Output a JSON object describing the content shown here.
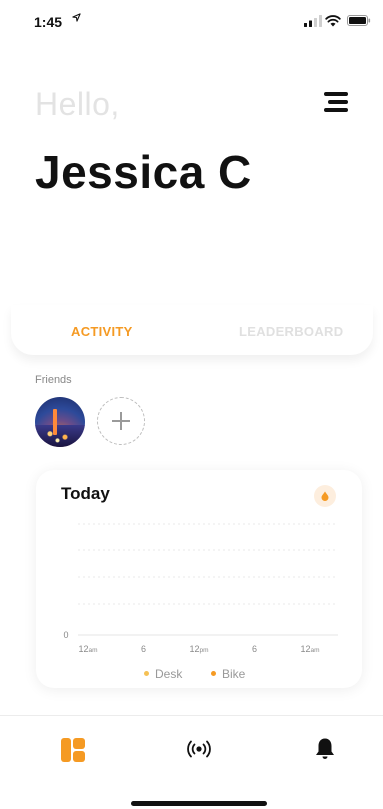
{
  "status_bar": {
    "time": "1:45",
    "location_icon": "location-arrow-icon",
    "signal_icon": "signal-icon",
    "wifi_icon": "wifi-icon",
    "battery_icon": "battery-icon"
  },
  "header": {
    "greeting": "Hello,",
    "user_name": "Jessica C",
    "menu_icon": "hamburger-menu-icon"
  },
  "tabs": [
    {
      "label": "ACTIVITY",
      "active": true
    },
    {
      "label": "LEADERBOARD",
      "active": false
    }
  ],
  "friends": {
    "label": "Friends",
    "add_icon": "plus-icon"
  },
  "today_card": {
    "title": "Today",
    "flame_icon": "flame-icon",
    "accent_color": "#f59a23"
  },
  "chart_data": {
    "type": "line",
    "x_ticks": [
      {
        "value": "12",
        "suffix": "am"
      },
      {
        "value": "6",
        "suffix": ""
      },
      {
        "value": "12",
        "suffix": "pm"
      },
      {
        "value": "6",
        "suffix": ""
      },
      {
        "value": "12",
        "suffix": "am"
      }
    ],
    "y_ticks": [
      "0"
    ],
    "grid": true,
    "series": [
      {
        "name": "Desk",
        "values": [],
        "color": "#f5c155"
      },
      {
        "name": "Bike",
        "values": [],
        "color": "#f59a23"
      }
    ],
    "legend_position": "bottom"
  },
  "bottom_nav": [
    {
      "icon": "dashboard-icon",
      "active": true
    },
    {
      "icon": "broadcast-icon",
      "active": false
    },
    {
      "icon": "bell-icon",
      "active": false
    }
  ]
}
